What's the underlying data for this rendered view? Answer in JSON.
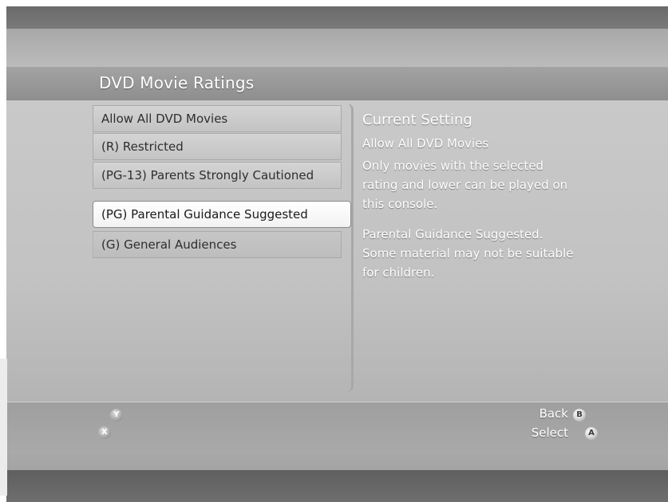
{
  "screen": {
    "title": "DVD Movie Ratings"
  },
  "rating_list": {
    "items": [
      {
        "label": "Allow All DVD Movies",
        "selected": false
      },
      {
        "label": "(R) Restricted",
        "selected": false
      },
      {
        "label": "(PG-13) Parents Strongly Cautioned",
        "selected": false
      },
      {
        "label": "(PG) Parental Guidance Suggested",
        "selected": true
      },
      {
        "label": "(G) General Audiences",
        "selected": false
      }
    ]
  },
  "detail": {
    "heading": "Current Setting",
    "current_value": "Allow All DVD Movies",
    "description_line1": "Only movies with the selected",
    "description_line2": "rating and lower can be played on",
    "description_line3": "this console.",
    "rating_desc_line1": "Parental Guidance Suggested.",
    "rating_desc_line2": "Some material may not be suitable",
    "rating_desc_line3": "for children."
  },
  "footer": {
    "y_button": "Y",
    "x_button": "X",
    "back_label": "Back",
    "back_button": "B",
    "select_label": "Select",
    "select_button": "A"
  },
  "icons": {
    "y": "controller-y-icon",
    "x": "controller-x-icon",
    "b": "controller-b-icon",
    "a": "controller-a-icon"
  }
}
